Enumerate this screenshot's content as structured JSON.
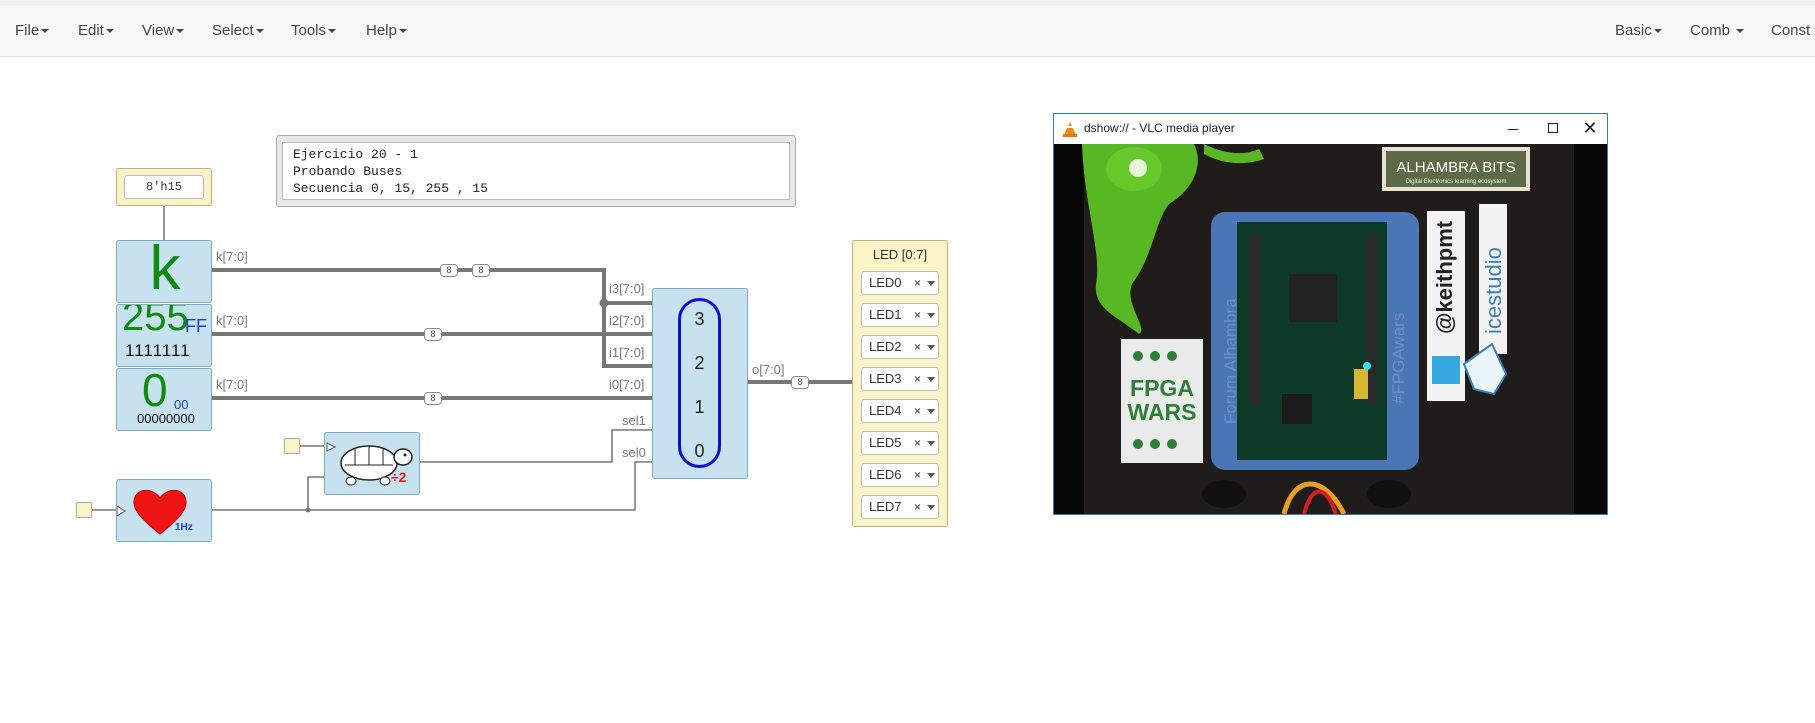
{
  "menus": {
    "left": [
      "File",
      "Edit",
      "View",
      "Select",
      "Tools",
      "Help"
    ],
    "right": [
      "Basic",
      "Comb",
      "Const"
    ]
  },
  "diagram": {
    "const_value": "8'h15",
    "comment_lines": [
      "Ejercicio 20 - 1",
      "Probando Buses",
      "Secuencia 0, 15, 255 , 15"
    ],
    "blocks": {
      "k_letter": "k",
      "display_255_dec": "255",
      "display_255_hex": "FF",
      "display_255_bin": "1111111",
      "display_0_dec": "0",
      "display_0_hex": "00",
      "display_0_bin": "00000000",
      "heart_freq": "1Hz",
      "turtle_div": "÷2"
    },
    "port_labels": {
      "k1": "k[7:0]",
      "k2": "k[7:0]",
      "k3": "k[7:0]",
      "i3": "i3[7:0]",
      "i2": "i2[7:0]",
      "i1": "i1[7:0]",
      "i0": "i0[7:0]",
      "sel1": "sel1",
      "sel0": "sel0",
      "out": "o[7:0]"
    },
    "wire_widths": {
      "w1": "8",
      "w1b": "8",
      "w2": "8",
      "w3": "8",
      "wout": "8"
    },
    "mux_values": [
      "3",
      "2",
      "1",
      "0"
    ],
    "led_panel": {
      "title": "LED [0:7]",
      "leds": [
        "LED0",
        "LED1",
        "LED2",
        "LED3",
        "LED4",
        "LED5",
        "LED6",
        "LED7"
      ],
      "remove_symbol": "×"
    }
  },
  "vlc": {
    "title": "dshow:// - VLC media player",
    "video_text": {
      "alhambra": "ALHAMBRA BITS",
      "alhambra_sub": "Digital Electronics learning ecosystem",
      "fpga": "FPGA",
      "wars": "WARS",
      "keith": "@keithpmt",
      "icestudio": "icestudio",
      "forum": "Forum Alhambra",
      "hashtag": "#FPGAwars"
    }
  }
}
